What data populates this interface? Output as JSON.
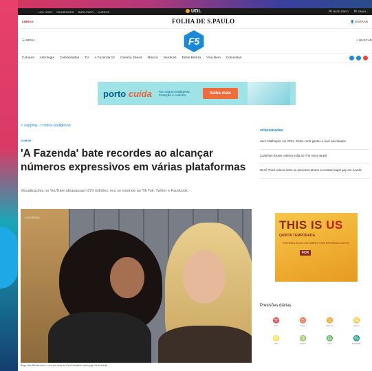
{
  "uolbar": {
    "links": [
      "UOL HOST",
      "PAGSEGURO",
      "BATE-PAPO",
      "CURSOS"
    ],
    "logo": "UOL",
    "right": [
      "BATE-PAPO",
      "EMAIL"
    ]
  },
  "masthead": {
    "live": "LIBRAS",
    "title": "FOLHA DE S.PAULO",
    "login": "ENTRAR"
  },
  "f5": {
    "menu": "MENU",
    "logo": "F5",
    "search": "BUSCAR"
  },
  "nav": [
    "Colunas",
    "Astrologia",
    "Celebridades",
    "TV",
    "A Fazenda 12",
    "Cinema Séries",
    "Música",
    "Nerdices",
    "Estilo Beleza",
    "Viva Bem",
    "Colunistas"
  ],
  "social_colors": [
    "#1a8ad6",
    "#1a8ad6",
    "#e8473a"
  ],
  "ad": {
    "brand": "porto",
    "brand2": "cuida",
    "tagline": "Seu seguro inteligente. Proteção e conforto.",
    "cta": "Saiba mais"
  },
  "article": {
    "crumb": "< zapping - cristina padiglione",
    "kicker": "HUMOR",
    "headline": "'A Fazenda' bate recordes ao alcançar números expressivos em várias plataformas",
    "standfirst": "Visualizações no YouTube ultrapassam 870 milhões; eco se estende ao Tik Tok, Twitter e Facebook",
    "photo_watermark": "A FAZENDA",
    "caption": "Briga fake Raissa surra e voa pra cima de Carol Narizinho após jogo da discórdia"
  },
  "sidebar": {
    "label": "relacionadas",
    "items": [
      "Sem 'Malhação' em 2021, Globo corta gastos e revê prioridades",
      "Carlinhos Brown celebra volta ao The Voice Brasil",
      "Gecê Third cobrou entre os primeiros atores a encarar papel gay em novela"
    ]
  },
  "sidead": {
    "line1a": "THIS IS ",
    "line1b": "US",
    "line2": "QUINTA TEMPORADA",
    "line3": "ESTREIA 28 DE OUTUBRO COM EPISÓDIO DUPLO",
    "line4": "FOX"
  },
  "previsoes": {
    "title": "Previsões diárias",
    "signs": [
      {
        "icon": "♈",
        "name": "Áries"
      },
      {
        "icon": "♉",
        "name": "Touro"
      },
      {
        "icon": "♊",
        "name": "Gêmeos"
      },
      {
        "icon": "♋",
        "name": "Câncer"
      },
      {
        "icon": "♌",
        "name": "Leão"
      },
      {
        "icon": "♍",
        "name": "Virgem"
      },
      {
        "icon": "♎",
        "name": "Libra"
      },
      {
        "icon": "♏",
        "name": "Escorpião"
      }
    ]
  }
}
